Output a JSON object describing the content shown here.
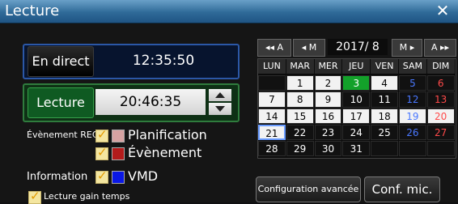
{
  "window": {
    "title": "Lecture",
    "close_symbol": "✕"
  },
  "live": {
    "button_label": "En direct",
    "time": "12:35:50"
  },
  "playback": {
    "button_label": "Lecture",
    "time": "20:46:35"
  },
  "rec_event": {
    "label": "Évènement REC",
    "items": [
      {
        "label": "Planification",
        "checked": true,
        "color": "#d6a2a2"
      },
      {
        "label": "Évènement",
        "checked": true,
        "color": "#b31b1b"
      }
    ]
  },
  "information": {
    "label": "Information",
    "checked": true,
    "item_label": "VMD",
    "color": "#0a18e6"
  },
  "gain_time": {
    "label": "Lecture gain temps",
    "checked": true
  },
  "calendar": {
    "nav": {
      "prev_year": "◂◂ A",
      "prev_month": "◂ M",
      "year_month": "2017/ 8",
      "next_month": "M ▸",
      "next_year": "A ▸▸"
    },
    "weekdays": [
      "LUN",
      "MAR",
      "MER",
      "JEU",
      "VEN",
      "SAM",
      "DIM"
    ],
    "rows": [
      [
        "",
        "1",
        "2",
        "3",
        "4",
        "5",
        "6"
      ],
      [
        "7",
        "8",
        "9",
        "10",
        "11",
        "12",
        "13"
      ],
      [
        "14",
        "15",
        "16",
        "17",
        "18",
        "19",
        "20"
      ],
      [
        "21",
        "22",
        "23",
        "24",
        "25",
        "26",
        "27"
      ],
      [
        "28",
        "29",
        "30",
        "31",
        "",
        "",
        ""
      ]
    ],
    "recorded_days": [
      "1",
      "2",
      "4",
      "7",
      "8",
      "9",
      "14",
      "15",
      "16",
      "17",
      "18",
      "19",
      "20"
    ],
    "selected_day": "3",
    "today": "21",
    "colors": {
      "sat": "#4a78ff",
      "sun": "#ff4a4a",
      "selected": "#13a12a",
      "recorded": "#f2f2f2",
      "today_border": "#6a9cff"
    }
  },
  "buttons": {
    "advanced_config": "Configuration avancée",
    "mic_config": "Conf. mic."
  }
}
